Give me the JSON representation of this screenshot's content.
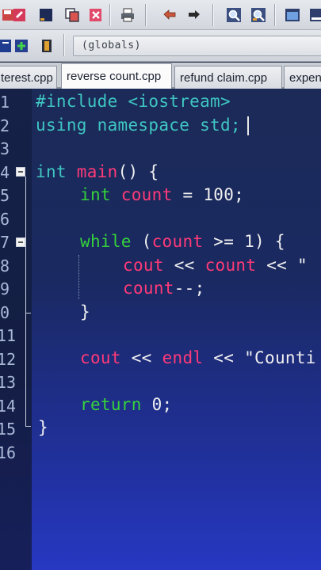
{
  "toolbar": {
    "icons": [
      "save-all-icon",
      "edit-icon",
      "square-icon",
      "copy-icon",
      "close-file-icon",
      "print-icon",
      "undo-icon",
      "redo-icon",
      "find-icon",
      "find-replace-icon",
      "window-icon",
      "minimize-window-icon"
    ]
  },
  "toolbar2": {
    "icons": [
      "new-document-icon",
      "new-class-icon",
      "file-icon"
    ],
    "scope": "(globals)"
  },
  "tabs": [
    {
      "label": "terest.cpp",
      "active": false
    },
    {
      "label": "reverse count.cpp",
      "active": true
    },
    {
      "label": "refund claim.cpp",
      "active": false
    },
    {
      "label": "expen",
      "active": false
    }
  ],
  "editor": {
    "line_numbers": [
      "1",
      "2",
      "3",
      "4",
      "5",
      "6",
      "7",
      "8",
      "9",
      "0",
      "11",
      "12",
      "13",
      "14",
      "15",
      "16"
    ],
    "lines": {
      "l1": {
        "a": "#include <iostream>"
      },
      "l2": {
        "a": "using namespace std;"
      },
      "l4": {
        "kw": "int",
        "fn": "main",
        "rest": "() {"
      },
      "l5": {
        "kw": "int",
        "var": "count",
        "rest": " = 100;"
      },
      "l7": {
        "kw": "while",
        "p1": " (",
        "var": "count",
        "rest": " >= 1) {"
      },
      "l8": {
        "a": "cout",
        "b": " << ",
        "c": "count",
        "d": " << \""
      },
      "l9": {
        "a": "count",
        "b": "--;"
      },
      "l10": {
        "a": "}"
      },
      "l12": {
        "a": "cout",
        "b": " << ",
        "c": "endl",
        "d": " << \"Counti"
      },
      "l14": {
        "kw": "return",
        "rest": " 0;"
      },
      "l15": {
        "a": "}"
      }
    }
  },
  "colors": {
    "preprocessor": "#3fc6c2",
    "keyword": "#35d13c",
    "identifier": "#ff3a78",
    "text": "#f0f0f0"
  }
}
